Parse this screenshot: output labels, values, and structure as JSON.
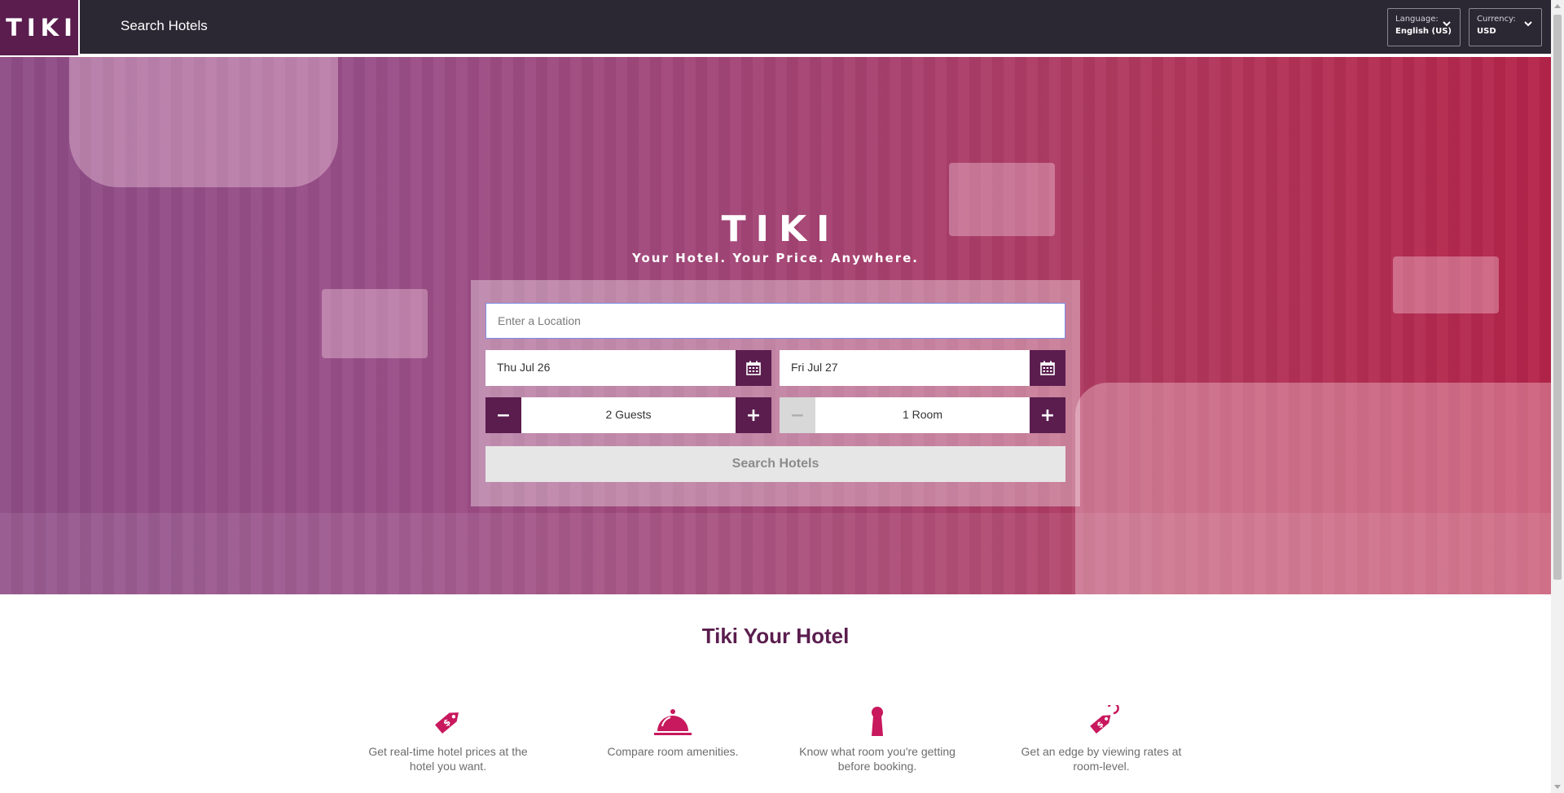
{
  "header": {
    "logo_text": "TIKI",
    "nav_link": "Search Hotels",
    "language": {
      "label": "Language:",
      "value": "English (US)"
    },
    "currency": {
      "label": "Currency:",
      "value": "USD"
    }
  },
  "hero": {
    "brand": "TIKI",
    "tagline": "Your Hotel. Your Price. Anywhere.",
    "search": {
      "location_placeholder": "Enter a Location",
      "location_value": "",
      "check_in": "Thu Jul 26",
      "check_out": "Fri Jul 27",
      "guests": "2 Guests",
      "rooms": "1 Room",
      "minus_glyph": "−",
      "plus_glyph": "+",
      "submit_label": "Search Hotels"
    }
  },
  "features": {
    "title": "Tiki Your Hotel",
    "items": [
      {
        "icon": "price-tag-icon",
        "text": "Get real-time hotel prices at the hotel you want."
      },
      {
        "icon": "room-service-bell-icon",
        "text": "Compare room amenities."
      },
      {
        "icon": "keyhole-icon",
        "text": "Know what room you're getting before booking."
      },
      {
        "icon": "hanging-tag-icon",
        "text": "Get an edge by viewing rates at room-level."
      }
    ]
  },
  "colors": {
    "brand_purple": "#5a1d4e",
    "header_bg": "#2b2833",
    "accent_pink": "#c8185e",
    "button_disabled": "#e6e6e6"
  }
}
